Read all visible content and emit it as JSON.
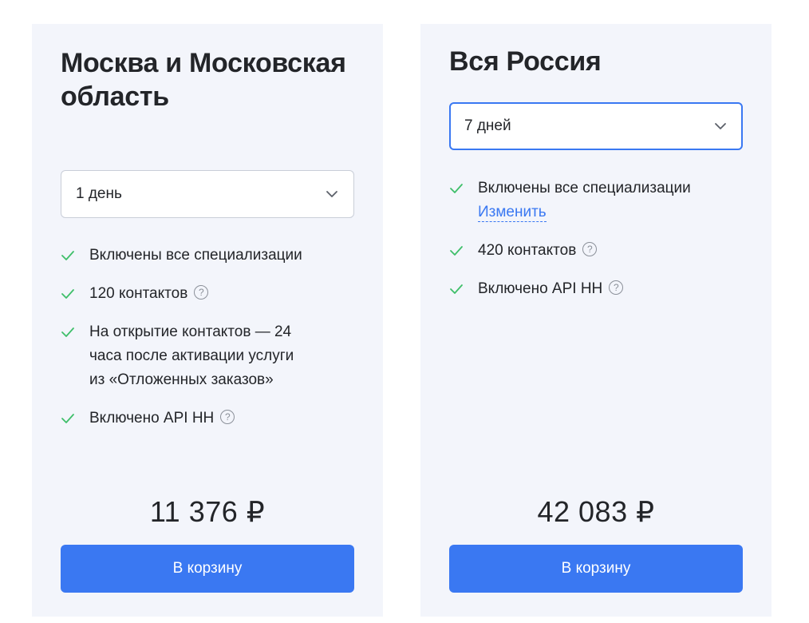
{
  "plans": [
    {
      "title": "Москва и Московская область",
      "period": "1 день",
      "features": [
        "Включены все специализации",
        "120 контактов",
        "На открытие контактов — 24 часа после активации услуги из «Отложенных заказов»",
        "Включено API HH"
      ],
      "price": "11 376 ₽",
      "cart_label": "В корзину"
    },
    {
      "title": "Вся Россия",
      "period": "7 дней",
      "features": [
        "Включены все специализации",
        "420 контактов",
        "Включено API HH"
      ],
      "change_link": "Изменить",
      "price": "42 083 ₽",
      "cart_label": "В корзину"
    }
  ],
  "help_glyph": "?",
  "colors": {
    "accent": "#3a78f2",
    "check": "#3fbf6a",
    "card_bg": "#f3f5fb"
  },
  "icons": {
    "check": "check-icon",
    "chevron": "chevron-down-icon",
    "help": "question-icon"
  }
}
